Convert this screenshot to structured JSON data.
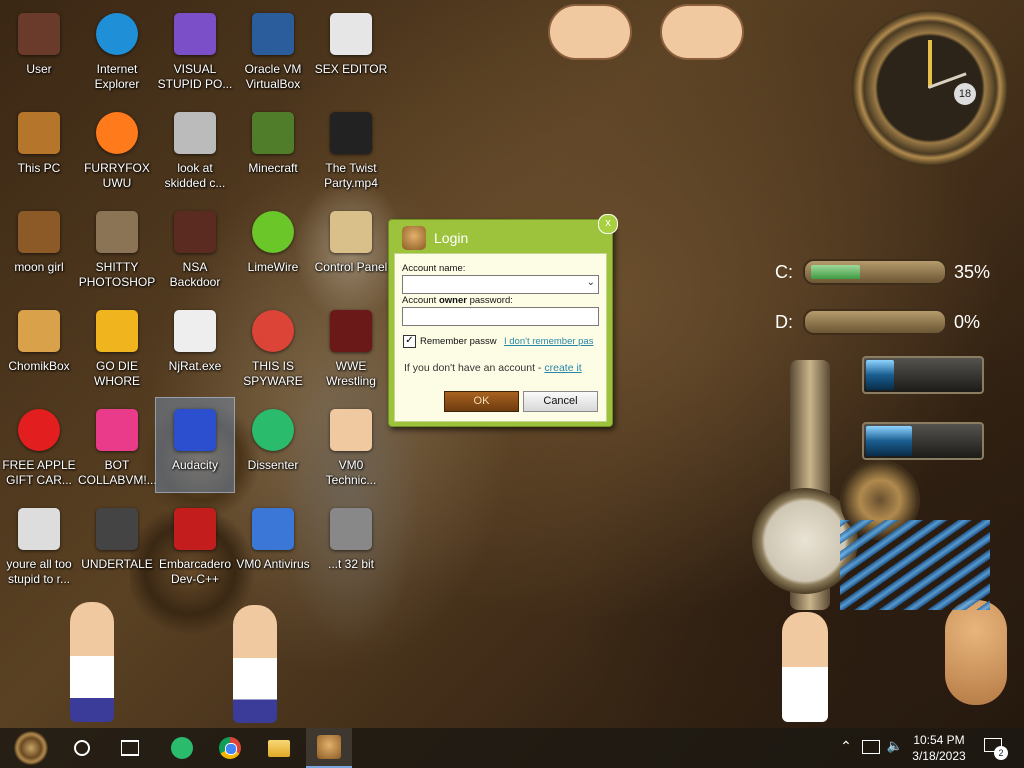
{
  "desktop": {
    "icons": [
      {
        "label": "User",
        "icon": "user-folder-icon"
      },
      {
        "label": "Internet Explorer",
        "icon": "edge-icon"
      },
      {
        "label": "VISUAL STUPID PO...",
        "icon": "visual-studio-icon"
      },
      {
        "label": "Oracle VM VirtualBox",
        "icon": "virtualbox-icon"
      },
      {
        "label": "SEX EDITOR",
        "icon": "hxd-editor-icon"
      },
      {
        "label": "This PC",
        "icon": "this-pc-icon"
      },
      {
        "label": "FURRYFOX UWU",
        "icon": "firefox-icon"
      },
      {
        "label": "look at skidded c...",
        "icon": "folder-stack-icon"
      },
      {
        "label": "Minecraft",
        "icon": "minecraft-icon"
      },
      {
        "label": "The Twist Party.mp4",
        "icon": "video-file-icon"
      },
      {
        "label": "moon girl",
        "icon": "chest-icon"
      },
      {
        "label": "SHITTY PHOTOSHOP",
        "icon": "gimp-icon"
      },
      {
        "label": "NSA Backdoor",
        "icon": "nsa-backdoor-icon"
      },
      {
        "label": "LimeWire",
        "icon": "limewire-icon"
      },
      {
        "label": "Control Panel",
        "icon": "control-panel-icon"
      },
      {
        "label": "ChomikBox",
        "icon": "chomikbox-icon"
      },
      {
        "label": "GO DIE WHORE",
        "icon": "dev-express-icon"
      },
      {
        "label": "NjRat.exe",
        "icon": "skull-icon"
      },
      {
        "label": "THIS IS SPYWARE",
        "icon": "chrome-icon"
      },
      {
        "label": "WWE Wrestling",
        "icon": "wwe-icon"
      },
      {
        "label": "FREE APPLE GIFT CAR...",
        "icon": "apple-icon"
      },
      {
        "label": "BOT COLLABVM!...",
        "icon": "bot-collabvm-icon"
      },
      {
        "label": "Audacity",
        "icon": "audacity-icon"
      },
      {
        "label": "Dissenter",
        "icon": "dissenter-icon"
      },
      {
        "label": "VM0 Technic...",
        "icon": "vm0-tech-icon"
      },
      {
        "label": "youre all too stupid to r...",
        "icon": "portrait-image-icon"
      },
      {
        "label": "UNDERTALE",
        "icon": "unity-icon"
      },
      {
        "label": "Embarcadero Dev-C++",
        "icon": "devcpp-icon"
      },
      {
        "label": "VM0 Antivirus",
        "icon": "shield-icon"
      },
      {
        "label": "...t 32 bit",
        "icon": "app-icon"
      }
    ]
  },
  "login_dialog": {
    "title": "Login",
    "close": "x",
    "account_name_label": "Account name:",
    "password_label_prefix": "Account ",
    "password_label_bold": "owner",
    "password_label_suffix": " password:",
    "remember_label": "Remember passw",
    "remember_checked": true,
    "forgot_link": "I don't remember pas",
    "no_account_text": "If you don't have an account - ",
    "create_link": "create it",
    "ok_label": "OK",
    "cancel_label": "Cancel"
  },
  "drive_gauges": [
    {
      "drive": "C:",
      "percent_text": "35%",
      "fill": 0.35
    },
    {
      "drive": "D:",
      "percent_text": "0%",
      "fill": 0.0
    }
  ],
  "clock_widget": {
    "date_day": "18"
  },
  "taskbar": {
    "items": [
      "start-icon",
      "search-circle-icon",
      "task-view-icon",
      "dissenter-taskbar-icon",
      "chrome-taskbar-icon",
      "file-explorer-icon",
      "chomikbox-taskbar-icon"
    ],
    "time": "10:54 PM",
    "date": "3/18/2023",
    "notification_count": "2"
  },
  "colors": {
    "dialog_green": "#9cc33b",
    "ok_button": "#8a4f16",
    "link_blue": "#2a86a8"
  }
}
